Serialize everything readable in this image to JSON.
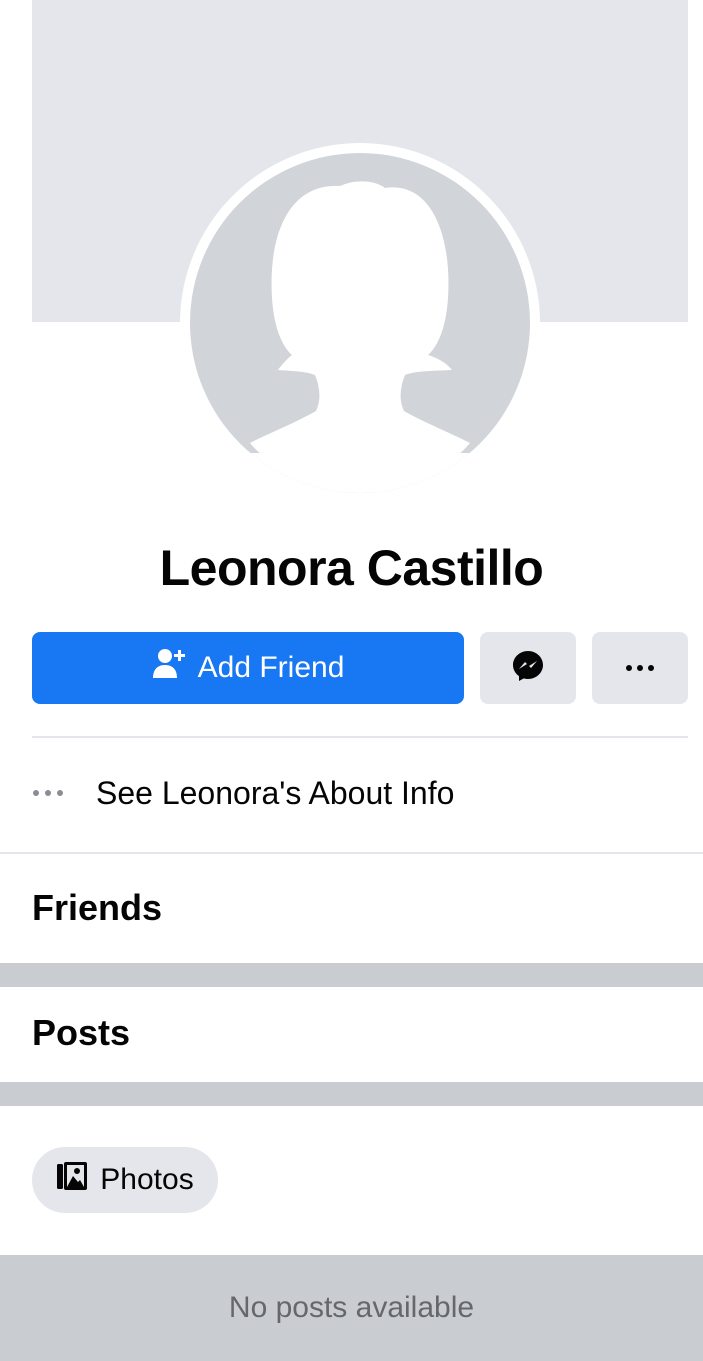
{
  "profile": {
    "name": "Leonora Castillo",
    "avatar_icon": "default-female-silhouette-icon"
  },
  "actions": {
    "add_friend_label": "Add Friend",
    "add_friend_icon": "add-person-icon",
    "message_icon": "messenger-icon",
    "more_icon": "more-dots-icon"
  },
  "about": {
    "label": "See Leonora's About Info",
    "icon": "more-dots-icon"
  },
  "sections": {
    "friends_title": "Friends",
    "posts_title": "Posts"
  },
  "filters": {
    "photos_label": "Photos",
    "photos_icon": "photos-icon"
  },
  "feed": {
    "empty_text": "No posts available"
  },
  "colors": {
    "primary": "#1877f2",
    "cover": "#e4e6eb",
    "avatar_bg": "#d1d4d9",
    "band": "#c9ccd1",
    "muted_text": "#65676b"
  }
}
